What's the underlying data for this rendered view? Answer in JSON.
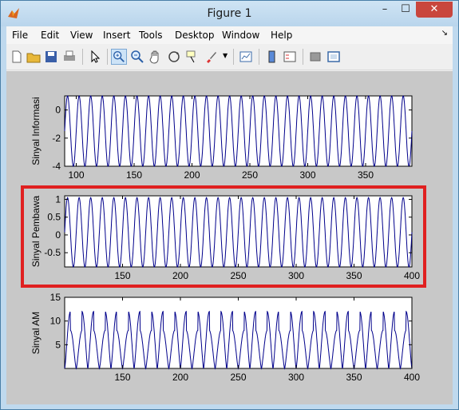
{
  "window": {
    "title": "Figure 1",
    "minimize": "–",
    "maximize": "☐",
    "close": "✕"
  },
  "menu": [
    "File",
    "Edit",
    "View",
    "Insert",
    "Tools",
    "Desktop",
    "Window",
    "Help"
  ],
  "menu_arrow": "↘",
  "toolbar": [
    "new-figure-icon",
    "open-file-icon",
    "save-icon",
    "print-icon",
    "pointer-icon",
    "zoom-in-icon",
    "zoom-out-icon",
    "pan-icon",
    "rotate-3d-icon",
    "data-cursor-icon",
    "brush-icon",
    "link-plot-icon",
    "colorbar-icon",
    "legend-icon",
    "hide-plot-tools-icon",
    "show-plot-tools-icon"
  ],
  "colors": {
    "line": "#00008b",
    "highlight": "#e02020",
    "canvas": "#c8c8c8"
  },
  "chart_data": [
    {
      "type": "line",
      "ylabel": "Sinyal Informasi",
      "xlim": [
        90,
        390
      ],
      "ylim": [
        -4,
        1
      ],
      "xticks": [
        "100",
        "150",
        "200",
        "250",
        "300",
        "350"
      ],
      "yticks": [
        "0",
        "-2",
        "-4"
      ],
      "waveform": {
        "kind": "sine",
        "period": 10,
        "min": -4,
        "max": 1
      }
    },
    {
      "type": "line",
      "ylabel": "Sinyal Pembawa",
      "xlim": [
        100,
        400
      ],
      "ylim": [
        -0.9,
        1.1
      ],
      "xticks": [
        "150",
        "200",
        "250",
        "300",
        "350",
        "400"
      ],
      "yticks": [
        "1",
        "0.5",
        "0",
        "-0.5"
      ],
      "waveform": {
        "kind": "sine",
        "period": 10,
        "min": -0.9,
        "max": 1.05
      }
    },
    {
      "type": "line",
      "ylabel": "Sinyal AM",
      "xlim": [
        100,
        400
      ],
      "ylim": [
        0,
        15
      ],
      "xticks": [
        "150",
        "200",
        "250",
        "300",
        "350",
        "400"
      ],
      "yticks": [
        "15",
        "10",
        "5"
      ],
      "waveform": {
        "kind": "am",
        "period": 10,
        "envelope_period": 20,
        "peaks": [
          12,
          8
        ],
        "min": 0
      }
    }
  ]
}
